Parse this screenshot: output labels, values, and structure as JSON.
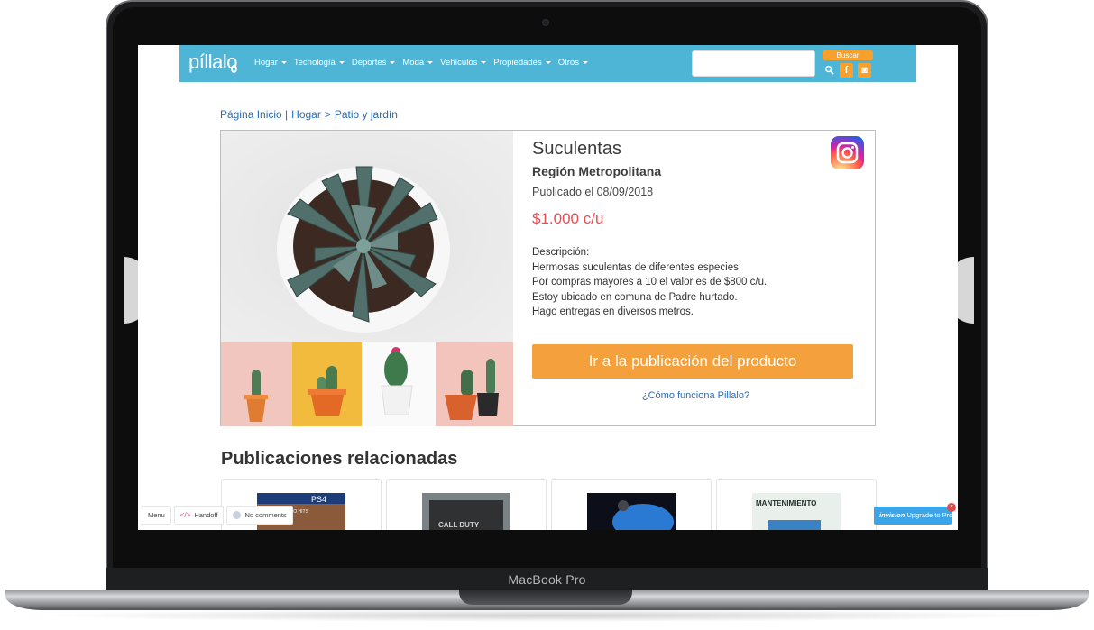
{
  "device": {
    "label": "MacBook Pro"
  },
  "navbar": {
    "logo": "píllalo",
    "items": [
      {
        "label": "Hogar"
      },
      {
        "label": "Tecnología"
      },
      {
        "label": "Deportes"
      },
      {
        "label": "Moda"
      },
      {
        "label": "Vehículos"
      },
      {
        "label": "Propiedades"
      },
      {
        "label": "Otros"
      }
    ],
    "search_placeholder": "",
    "search_button": "Buscar",
    "facebook": "f",
    "instagram": "◙"
  },
  "breadcrumb": {
    "home": "Página Inicio |",
    "category": "Hogar",
    "separator": ">",
    "subcategory": "Patio y jardín"
  },
  "product": {
    "title": "Suculentas",
    "region": "Región Metropolitana",
    "published": "Publicado el 08/09/2018",
    "price": "$1.000 c/u",
    "description_label": "Descripción:",
    "description_lines": [
      "Hermosas suculentas de diferentes especies.",
      "Por compras mayores a 10 el valor es de $800 c/u.",
      "Estoy ubicado en comuna de Padre hurtado.",
      "Hago entregas en diversos metros."
    ],
    "cta": "Ir a la publicación del producto",
    "how_it_works": "¿Cómo funciona Pillalo?"
  },
  "related": {
    "title": "Publicaciones relacionadas",
    "cards": [
      {
        "caption": "PS4",
        "sub": "ACKO HITS"
      },
      {
        "caption": "CALL DUTY",
        "sub": ""
      },
      {
        "caption": "",
        "sub": ""
      },
      {
        "caption": "MANTENIMIENTO",
        "sub": ""
      }
    ]
  },
  "invision": {
    "menu": "Menu",
    "handoff_code": "</>",
    "handoff": "Handoff",
    "comments": "No comments",
    "upgrade_brand": "invision",
    "upgrade": "Upgrade to Pro",
    "close": "×"
  },
  "colors": {
    "nav": "#4fb5d6",
    "accent": "#f4a13d",
    "price": "#ec4c52",
    "link": "#2a6cb4"
  }
}
